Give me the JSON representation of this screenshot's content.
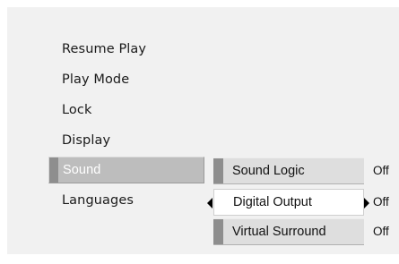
{
  "main_menu": {
    "items": [
      {
        "label": "Resume Play"
      },
      {
        "label": "Play Mode"
      },
      {
        "label": "Lock"
      },
      {
        "label": "Display"
      },
      {
        "label": "Sound"
      },
      {
        "label": "Languages"
      }
    ],
    "selected": "Sound"
  },
  "submenu": {
    "items": [
      {
        "label": "Sound Logic",
        "value": "Off"
      },
      {
        "label": "Digital Output",
        "value": "Off"
      },
      {
        "label": "Virtual Surround",
        "value": "Off"
      }
    ],
    "highlighted": "Digital Output"
  },
  "colors": {
    "panel_background": "#f1f1f1",
    "selected_background": "#bdbdbd",
    "accent_bar": "#8e8e8e",
    "submenu_background": "#dedede",
    "highlight_background": "#ffffff"
  },
  "icons": {
    "left_arrow": "triangle-left-icon",
    "right_arrow": "triangle-right-icon"
  }
}
